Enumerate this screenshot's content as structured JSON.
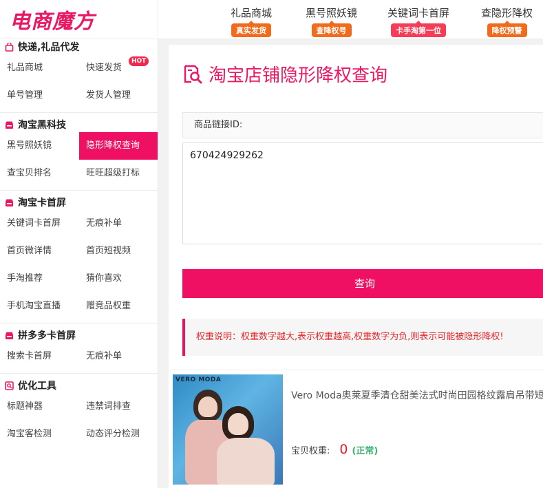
{
  "header": {
    "logo": "电商魔方",
    "nav": [
      {
        "label": "礼品商城",
        "badge": "真实发货",
        "badge_color": "#f26b1d"
      },
      {
        "label": "黑号照妖镜",
        "badge": "查降权号",
        "badge_color": "#f26b1d"
      },
      {
        "label": "关键词卡首屏",
        "badge": "卡手淘第一位",
        "badge_color": "#f53d57"
      },
      {
        "label": "查隐形降权",
        "badge": "降权预警",
        "badge_color": "#f26b1d"
      }
    ]
  },
  "sidebar": {
    "sections": [
      {
        "title": "快递,礼品代发",
        "icon": "bag-icon",
        "items": [
          {
            "label": "礼品商城"
          },
          {
            "label": "快速发货",
            "badge": "HOT"
          },
          {
            "label": "单号管理"
          },
          {
            "label": "发货人管理"
          }
        ]
      },
      {
        "title": "淘宝黑科技",
        "icon": "store-icon",
        "items": [
          {
            "label": "黑号照妖镜"
          },
          {
            "label": "隐形降权查询",
            "active": true
          },
          {
            "label": "查宝贝排名"
          },
          {
            "label": "旺旺超级打标"
          }
        ]
      },
      {
        "title": "淘宝卡首屏",
        "icon": "store-icon",
        "items": [
          {
            "label": "关键词卡首屏"
          },
          {
            "label": "无痕补单"
          },
          {
            "label": "首页微详情"
          },
          {
            "label": "首页短视频"
          },
          {
            "label": "手淘推荐"
          },
          {
            "label": "猜你喜欢"
          },
          {
            "label": "手机淘宝直播"
          },
          {
            "label": "赠竞品权重"
          }
        ]
      },
      {
        "title": "拼多多卡首屏",
        "icon": "store-icon",
        "items": [
          {
            "label": "搜索卡首屏"
          },
          {
            "label": "无痕补单"
          }
        ]
      },
      {
        "title": "优化工具",
        "icon": "tool-icon",
        "items": [
          {
            "label": "标题神器"
          },
          {
            "label": "违禁词排查"
          },
          {
            "label": "淘宝客检测"
          },
          {
            "label": "动态评分检测"
          }
        ]
      }
    ]
  },
  "main": {
    "title": "淘宝店铺隐形降权查询",
    "field_label": "商品链接ID:",
    "id_value": "670424929262",
    "query_button": "查询",
    "notice": "权重说明：权重数字越大,表示权重越高,权重数字为负,则表示可能被隐形降权!"
  },
  "product": {
    "brand": "VERO MODA",
    "title": "Vero Moda奥莱夏季清仓甜美法式时尚田园格纹露肩吊带短",
    "weight_label": "宝贝权重:",
    "weight_value": "0",
    "weight_status": "(正常)"
  },
  "colors": {
    "accent": "#ef0f63",
    "notice_text": "#e8282b",
    "status_ok": "#3cb371"
  }
}
